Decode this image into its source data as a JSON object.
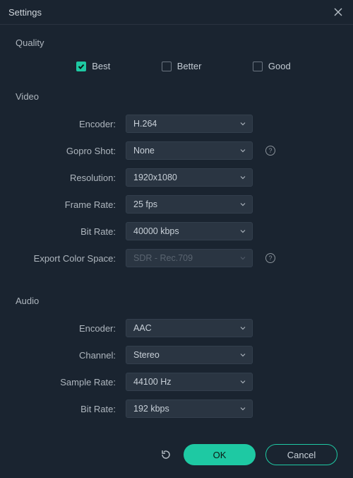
{
  "title": "Settings",
  "sections": {
    "quality": {
      "title": "Quality",
      "options": {
        "best": "Best",
        "better": "Better",
        "good": "Good"
      },
      "selected": "best"
    },
    "video": {
      "title": "Video",
      "encoder": {
        "label": "Encoder:",
        "value": "H.264"
      },
      "gopro": {
        "label": "Gopro Shot:",
        "value": "None"
      },
      "resolution": {
        "label": "Resolution:",
        "value": "1920x1080"
      },
      "framerate": {
        "label": "Frame Rate:",
        "value": "25 fps"
      },
      "bitrate": {
        "label": "Bit Rate:",
        "value": "40000 kbps"
      },
      "colorspace": {
        "label": "Export Color Space:",
        "value": "SDR - Rec.709"
      }
    },
    "audio": {
      "title": "Audio",
      "encoder": {
        "label": "Encoder:",
        "value": "AAC"
      },
      "channel": {
        "label": "Channel:",
        "value": "Stereo"
      },
      "samplerate": {
        "label": "Sample Rate:",
        "value": "44100 Hz"
      },
      "bitrate": {
        "label": "Bit Rate:",
        "value": "192 kbps"
      }
    }
  },
  "buttons": {
    "ok": "OK",
    "cancel": "Cancel"
  },
  "colors": {
    "accent": "#1ec9a3",
    "background": "#1a2430",
    "input": "#2a3542"
  }
}
